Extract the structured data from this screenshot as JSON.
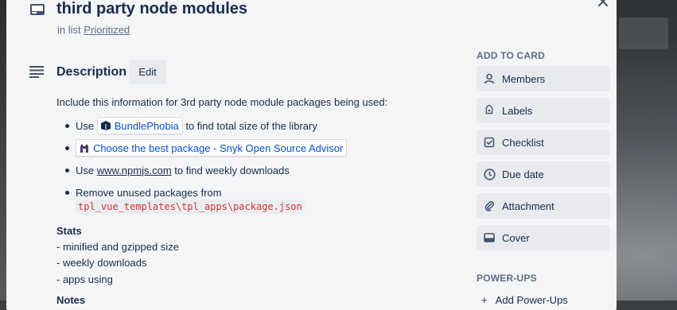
{
  "card": {
    "title": "third party node modules",
    "in_list_prefix": "in list",
    "list_name": "Prioritized"
  },
  "description": {
    "heading": "Description",
    "edit_label": "Edit",
    "intro": "Include this information for 3rd party node module packages being used:",
    "bullets": [
      {
        "before": "Use",
        "link": "BundlePhobia",
        "after": "to find total size of the library"
      },
      {
        "link": "Choose the best package - Snyk Open Source Advisor"
      },
      {
        "before": "Use",
        "link": "www.npmjs.com",
        "after": "to find weekly downloads"
      },
      {
        "text": "Remove unused packages from",
        "code": "tpl_vue_templates\\tpl_apps\\package.json"
      }
    ],
    "stats_heading": "Stats",
    "stats": [
      "- minified and gzipped size",
      "- weekly downloads",
      "- apps using"
    ],
    "notes_heading": "Notes"
  },
  "sidebar": {
    "add_to_card_heading": "ADD TO CARD",
    "buttons": [
      {
        "label": "Members",
        "icon": "person-icon"
      },
      {
        "label": "Labels",
        "icon": "label-icon"
      },
      {
        "label": "Checklist",
        "icon": "checklist-icon"
      },
      {
        "label": "Due date",
        "icon": "clock-icon"
      },
      {
        "label": "Attachment",
        "icon": "paperclip-icon"
      },
      {
        "label": "Cover",
        "icon": "cover-icon"
      }
    ],
    "powerups_heading": "POWER-UPS",
    "add_powerup": "Add Power-Ups"
  }
}
